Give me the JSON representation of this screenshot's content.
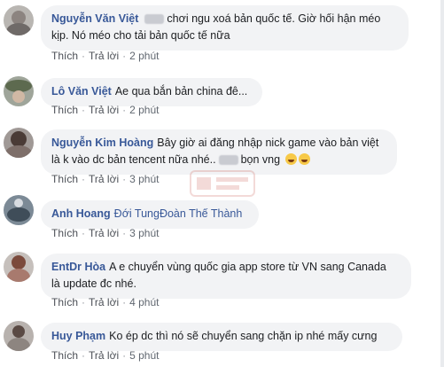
{
  "comments": [
    {
      "name": "Nguyễn Văn Việt",
      "line1": "chơi ngu xoá bản quốc tế. Giờ hối hận méo",
      "line2": "kịp. Nó méo cho tải bản quốc tế nữa",
      "like": "Thích",
      "reply": "Trả lời",
      "time": "2 phút"
    },
    {
      "name": "Lô Văn Việt",
      "line1": "Ae qua bắn bản china đê...",
      "like": "Thích",
      "reply": "Trả lời",
      "time": "2 phút"
    },
    {
      "name": "Nguyễn Kim Hoàng",
      "line1": "Bây giờ ai đăng nhập nick game vào bản việt",
      "line2_a": "là k vào dc bản tencent nữa nhé..",
      "line2_b": "bọn vng",
      "like": "Thích",
      "reply": "Trả lời",
      "time": "3 phút"
    },
    {
      "name": "Anh Hoang",
      "mention": "Đới TungĐoàn Thế Thành",
      "like": "Thích",
      "reply": "Trả lời",
      "time": "3 phút"
    },
    {
      "name": "EntDr Hòa",
      "line1": "A e chuyển vùng quốc gia app store từ VN sang Canada",
      "line2": "là update đc nhé.",
      "like": "Thích",
      "reply": "Trả lời",
      "time": "4 phút"
    },
    {
      "name": "Huy Phạm",
      "line1": "Ko ép dc thì nó sẽ chuyển sang chặn ip nhé mấy cưng",
      "like": "Thích",
      "reply": "Trả lời",
      "time": "5 phút"
    }
  ]
}
